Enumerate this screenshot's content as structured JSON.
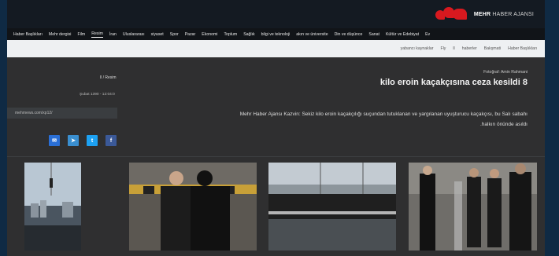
{
  "logo": {
    "name": "MEHR",
    "suffix": "HABER AJANSI"
  },
  "nav": {
    "items": [
      {
        "label": "Haber Başlıkları"
      },
      {
        "label": "Mehr dergisi"
      },
      {
        "label": "Film"
      },
      {
        "label": "Resim",
        "active": true
      },
      {
        "label": "İran"
      },
      {
        "label": "Uluslararası"
      },
      {
        "label": "siyaset"
      },
      {
        "label": "Spor"
      },
      {
        "label": "Pazar"
      },
      {
        "label": "Ekonomi"
      },
      {
        "label": "Toplum"
      },
      {
        "label": "Sağlık"
      },
      {
        "label": "bilgi ve teknoloji"
      },
      {
        "label": "akın ve üniversite"
      },
      {
        "label": "Din ve düşünce"
      },
      {
        "label": "Sanat"
      },
      {
        "label": "Kültür ve Edebiyat"
      },
      {
        "label": "Ev"
      }
    ]
  },
  "subnav": {
    "items": [
      {
        "label": "yabancı kaynaklar"
      },
      {
        "label": "Fly"
      },
      {
        "label": "ll"
      },
      {
        "label": "haberler"
      },
      {
        "label": "Bakşmati"
      },
      {
        "label": "Haber Başlıkları"
      }
    ]
  },
  "article": {
    "breadcrumb": "ll / Resim",
    "date": "Şubat 1390 - 12:04:0",
    "short_url": "mehrnews.com/xp12/",
    "photographer": "Fotoğraf: Amin Rahmani",
    "headline": "kilo eroin kaçakçısına ceza kesildi 8",
    "lead_line1": "Mehr Haber Ajansı Kazvin: Sekiz kilo eroin kaçakçılığı suçundan tutuklanan ve yargılanan uyuşturucu kaçakçısı, bu Salı sabahı",
    "lead_line2": ".halkın önünde asıldı"
  },
  "share": {
    "buttons": [
      {
        "name": "share-email-button",
        "icon": "email-icon",
        "color": "#2a6fd6",
        "glyph": "✉"
      },
      {
        "name": "share-telegram-button",
        "icon": "telegram-icon",
        "color": "#3a8fd0",
        "glyph": "➤"
      },
      {
        "name": "share-twitter-button",
        "icon": "twitter-icon",
        "color": "#1da1f2",
        "glyph": "t"
      },
      {
        "name": "share-facebook-button",
        "icon": "facebook-icon",
        "color": "#3b5998",
        "glyph": "f"
      }
    ]
  },
  "colors": {
    "brand": "#d8191f",
    "page_bg": "#2f2f30",
    "topbar": "#141a22"
  }
}
